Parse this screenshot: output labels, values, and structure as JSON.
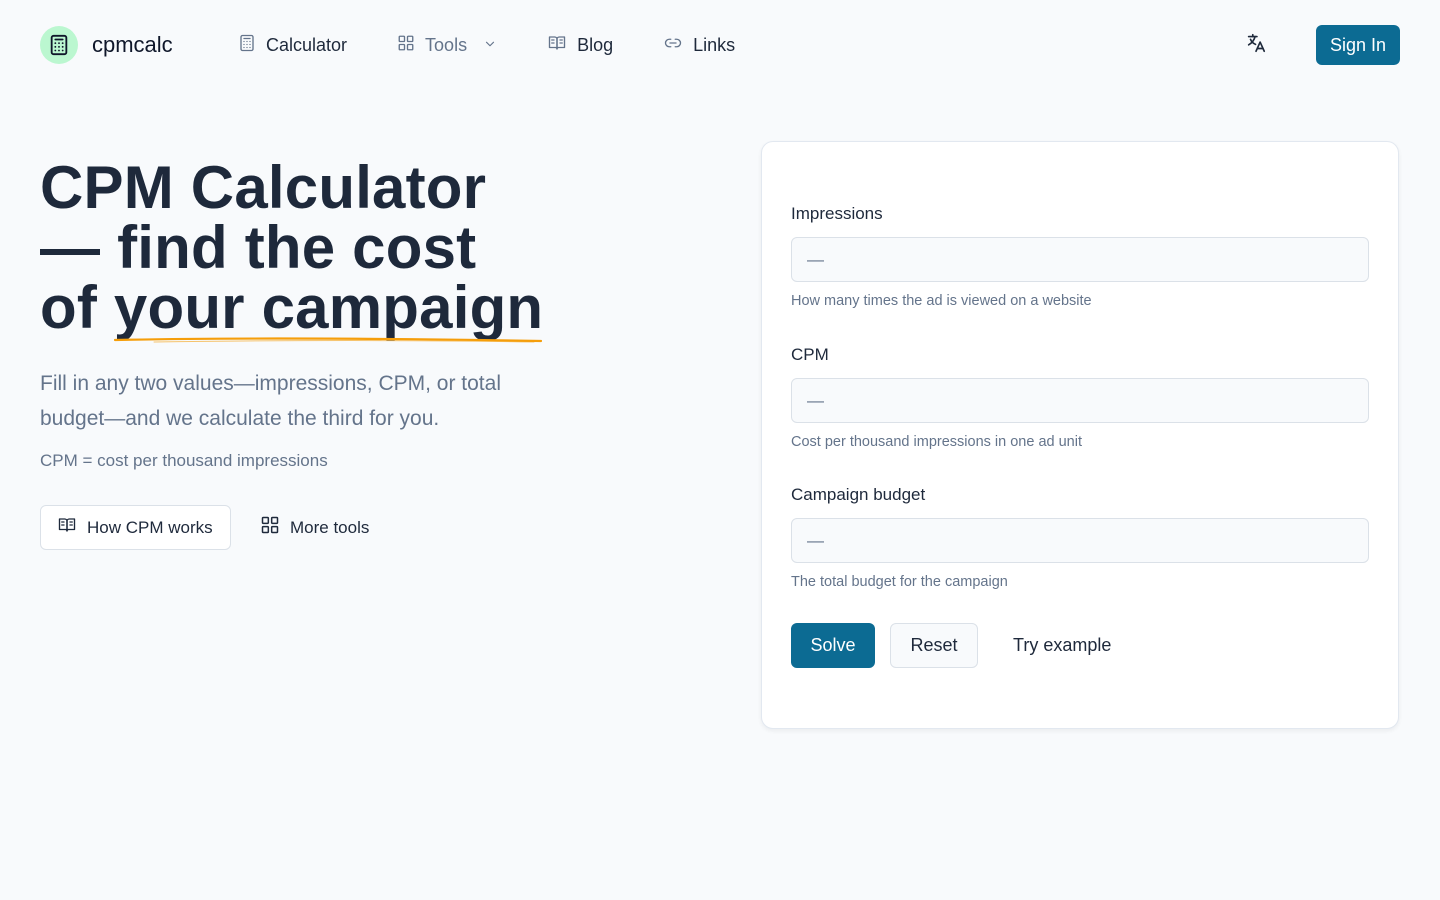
{
  "header": {
    "logo_text": "cpmcalc",
    "nav": [
      {
        "label": "Calculator",
        "icon": "calculator-icon"
      },
      {
        "label": "Tools",
        "icon": "grid-icon"
      },
      {
        "label": "Blog",
        "icon": "book-icon"
      },
      {
        "label": "Links",
        "icon": "link-icon"
      }
    ],
    "language_icon": "translate-icon",
    "signin_label": "Sign In"
  },
  "hero": {
    "title_line1": "CPM Calculator",
    "title_line2": "— find the cost",
    "title_line3_a": "of ",
    "title_line3_b": "your campaign",
    "subtitle": "Fill in any two values—impressions, CPM, or total budget—and we calculate the third for you.",
    "note": "CPM = cost per thousand impressions",
    "how_button": "How CPM works",
    "more_button": "More tools"
  },
  "form": {
    "fields": [
      {
        "label": "Impressions",
        "placeholder": "—",
        "help": "How many times the ad is viewed on a website"
      },
      {
        "label": "CPM",
        "placeholder": "—",
        "help": "Cost per thousand impressions in one ad unit"
      },
      {
        "label": "Campaign budget",
        "placeholder": "—",
        "help": "The total budget for the campaign"
      }
    ],
    "solve_label": "Solve",
    "reset_label": "Reset",
    "try_label": "Try example"
  },
  "colors": {
    "primary": "#0c6b93",
    "logo_badge": "#bbf7d0",
    "underline": "#f59e0b",
    "text_dark": "#1e293b",
    "text_muted": "#64748b",
    "background": "#f8fafc"
  }
}
